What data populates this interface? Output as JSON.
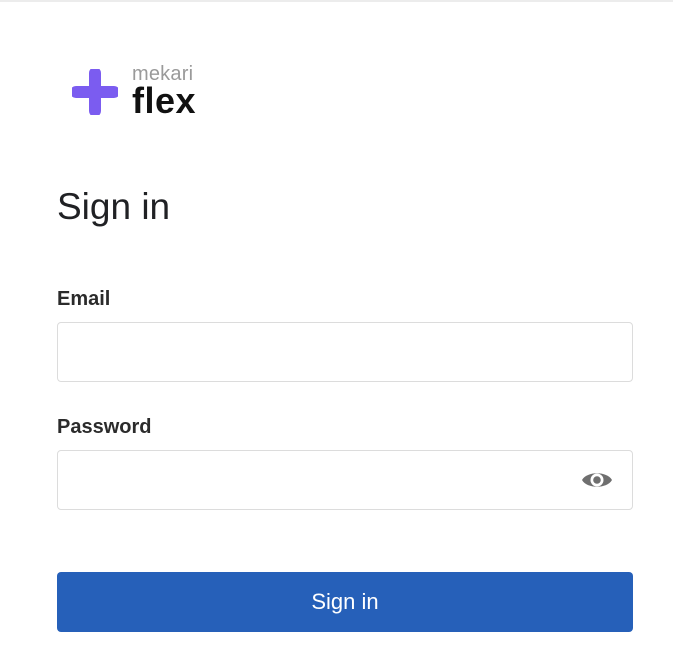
{
  "brand": {
    "company": "mekari",
    "product": "flex",
    "mark_color": "#7b5cf0"
  },
  "title": "Sign in",
  "form": {
    "email": {
      "label": "Email",
      "value": "",
      "placeholder": ""
    },
    "password": {
      "label": "Password",
      "value": "",
      "placeholder": "",
      "visibility_icon": "eye-icon"
    },
    "submit_label": "Sign in"
  },
  "colors": {
    "primary_button": "#2660b9",
    "label_text": "#2b2b2b",
    "input_border": "#dcdcdc"
  }
}
